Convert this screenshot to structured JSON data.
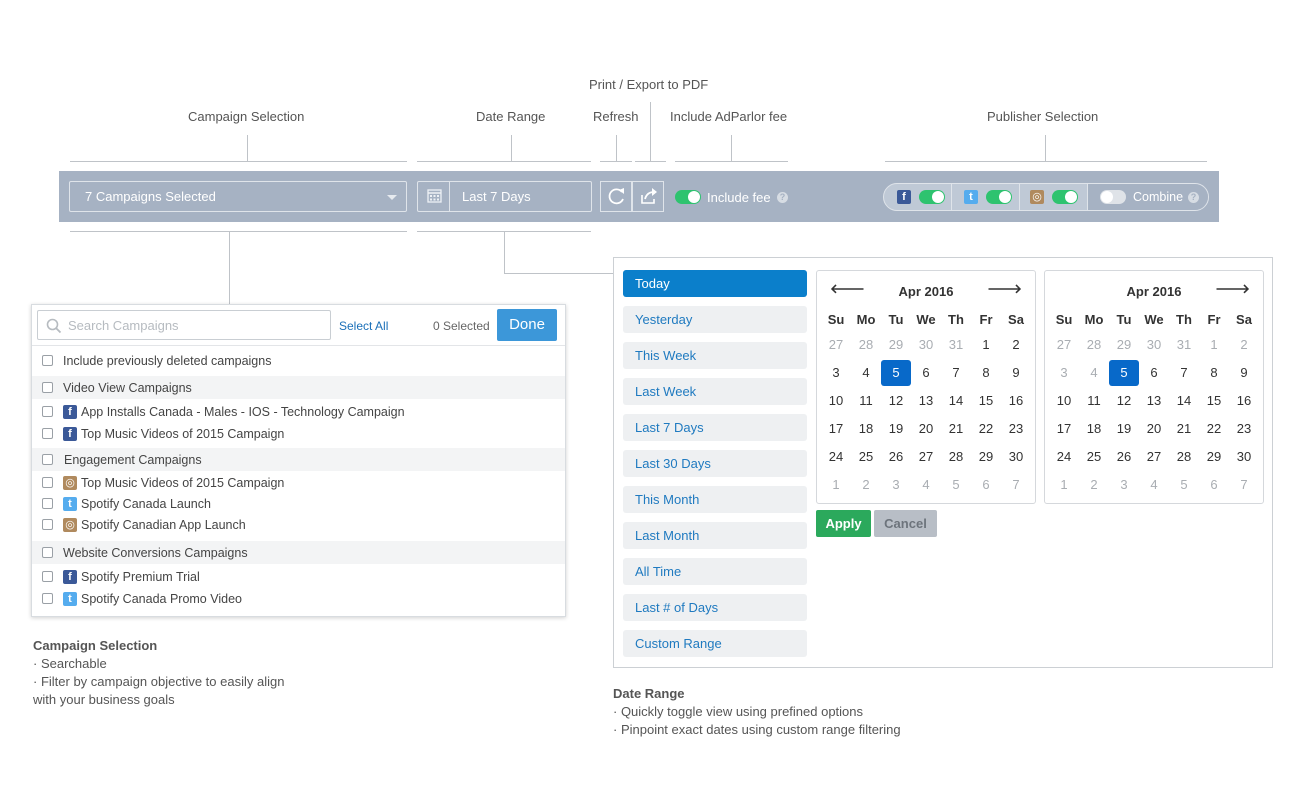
{
  "callouts": {
    "campaign_selection": "Campaign Selection",
    "date_range": "Date Range",
    "print_export": "Print / Export to PDF",
    "refresh": "Refresh",
    "include_fee": "Include AdParlor fee",
    "publisher_selection": "Publisher Selection"
  },
  "toolbar": {
    "campaign_select_value": "7 Campaigns Selected",
    "date_value": "Last 7 Days",
    "include_fee_label": "Include fee",
    "include_fee_on": true,
    "help_glyph": "?",
    "publishers": [
      {
        "icon": "facebook-icon",
        "glyph": "f",
        "on": true
      },
      {
        "icon": "twitter-icon",
        "glyph": "t",
        "on": true
      },
      {
        "icon": "instagram-icon",
        "glyph": "◎",
        "on": true
      }
    ],
    "combine_label": "Combine",
    "combine_on": false
  },
  "campaign_panel": {
    "search_placeholder": "Search Campaigns",
    "select_all": "Select All",
    "selected_count": "0 Selected",
    "done": "Done",
    "include_deleted": "Include previously deleted campaigns",
    "groups": [
      {
        "name": "Video View Campaigns",
        "items": [
          {
            "icon": "facebook-icon",
            "glyph": "f",
            "label": "App Installs Canada - Males - IOS - Technology Campaign"
          },
          {
            "icon": "facebook-icon",
            "glyph": "f",
            "label": "Top Music Videos of 2015 Campaign"
          }
        ]
      },
      {
        "name": "Engagement Campaigns",
        "items": [
          {
            "icon": "instagram-icon",
            "glyph": "◎",
            "label": "Top Music Videos of 2015 Campaign"
          },
          {
            "icon": "twitter-icon",
            "glyph": "t",
            "label": "Spotify Canada Launch"
          },
          {
            "icon": "instagram-icon",
            "glyph": "◎",
            "label": "Spotify Canadian App Launch"
          }
        ]
      },
      {
        "name": "Website Conversions Campaigns",
        "items": [
          {
            "icon": "facebook-icon",
            "glyph": "f",
            "label": "Spotify Premium Trial"
          },
          {
            "icon": "twitter-icon",
            "glyph": "t",
            "label": "Spotify Canada Promo Video"
          }
        ]
      }
    ]
  },
  "date_panel": {
    "ranges": [
      "Today",
      "Yesterday",
      "This Week",
      "Last Week",
      "Last 7 Days",
      "Last 30 Days",
      "This Month",
      "Last Month",
      "All Time",
      "Last # of Days",
      "Custom Range"
    ],
    "active_range": "Today",
    "calendars": [
      {
        "month": "Apr 2016",
        "prev_arrow": "🡐",
        "next_arrow": "🡒",
        "weekdays": [
          "Su",
          "Mo",
          "Tu",
          "We",
          "Th",
          "Fr",
          "Sa"
        ],
        "weeks": [
          [
            "27",
            "28",
            "29",
            "30",
            "31",
            "1",
            "2"
          ],
          [
            "3",
            "4",
            "5",
            "6",
            "7",
            "8",
            "9"
          ],
          [
            "10",
            "11",
            "12",
            "13",
            "14",
            "15",
            "16"
          ],
          [
            "17",
            "18",
            "19",
            "20",
            "21",
            "22",
            "23"
          ],
          [
            "24",
            "25",
            "26",
            "27",
            "28",
            "29",
            "30"
          ],
          [
            "1",
            "2",
            "3",
            "4",
            "5",
            "6",
            "7"
          ]
        ],
        "selected": "5"
      },
      {
        "month": "Apr 2016",
        "prev_arrow": "",
        "next_arrow": "🡒",
        "weekdays": [
          "Su",
          "Mo",
          "Tu",
          "We",
          "Th",
          "Fr",
          "Sa"
        ],
        "weeks": [
          [
            "27",
            "28",
            "29",
            "30",
            "31",
            "1",
            "2"
          ],
          [
            "3",
            "4",
            "5",
            "6",
            "7",
            "8",
            "9"
          ],
          [
            "10",
            "11",
            "12",
            "13",
            "14",
            "15",
            "16"
          ],
          [
            "17",
            "18",
            "19",
            "20",
            "21",
            "22",
            "23"
          ],
          [
            "24",
            "25",
            "26",
            "27",
            "28",
            "29",
            "30"
          ],
          [
            "1",
            "2",
            "3",
            "4",
            "5",
            "6",
            "7"
          ]
        ],
        "selected": "5"
      }
    ],
    "apply": "Apply",
    "cancel": "Cancel"
  },
  "descriptions": {
    "campaign": {
      "title": "Campaign Selection",
      "lines": [
        "· Searchable",
        "· Filter by campaign objective to easily align",
        "with your business goals"
      ]
    },
    "date": {
      "title": "Date Range",
      "lines": [
        "· Quickly toggle view using prefined options",
        "· Pinpoint exact dates using custom range filtering"
      ]
    }
  },
  "colors": {
    "toolbar_bg": "#a6b2c3",
    "accent_blue": "#0b7fcb",
    "toggle_on": "#2ec36f",
    "apply_green": "#2ba95c"
  }
}
